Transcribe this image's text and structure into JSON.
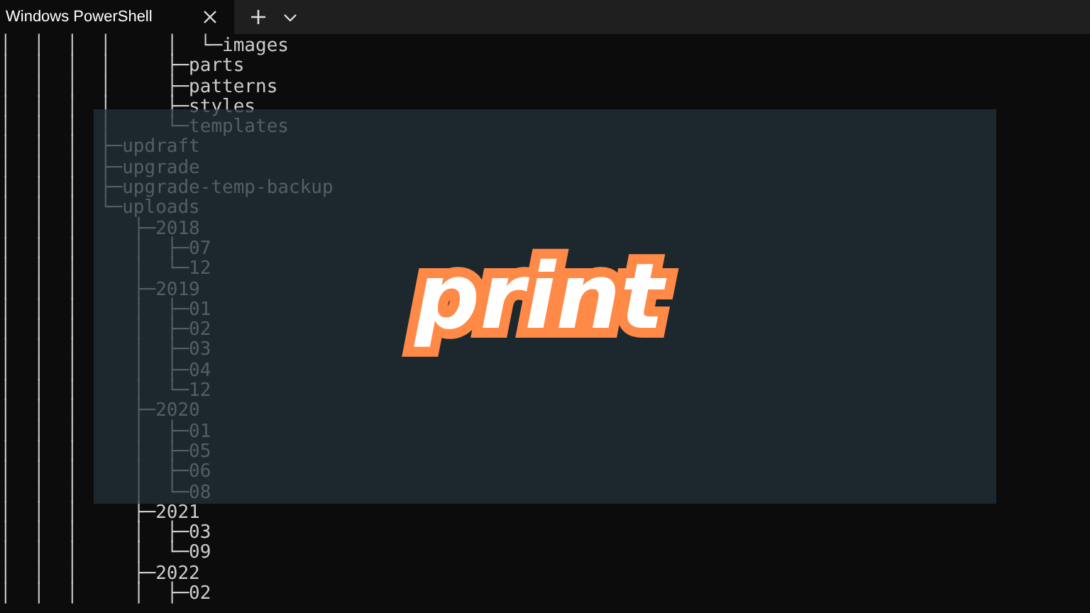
{
  "tab": {
    "title": "Windows PowerShell",
    "selected": true
  },
  "terminal_lines": [
    "│  │  │  │     │  └─images",
    "│  │  │  │     ├─parts",
    "│  │  │  │     ├─patterns",
    "│  │  │  │     ├─styles",
    "│  │  │  │     └─templates",
    "│  │  │  ├─updraft",
    "│  │  │  ├─upgrade",
    "│  │  │  ├─upgrade-temp-backup",
    "│  │  │  └─uploads",
    "│  │  │     ├─2018",
    "│  │  │     │  ├─07",
    "│  │  │     │  └─12",
    "│  │  │     ├─2019",
    "│  │  │     │  ├─01",
    "│  │  │     │  ├─02",
    "│  │  │     │  ├─03",
    "│  │  │     │  ├─04",
    "│  │  │     │  └─12",
    "│  │  │     ├─2020",
    "│  │  │     │  ├─01",
    "│  │  │     │  ├─05",
    "│  │  │     │  ├─06",
    "│  │  │     │  └─08",
    "│  │  │     ├─2021",
    "│  │  │     │  ├─03",
    "│  │  │     │  └─09",
    "│  │  │     ├─2022",
    "│  │  │     │  ├─02"
  ],
  "overlay": {
    "text": "print"
  }
}
